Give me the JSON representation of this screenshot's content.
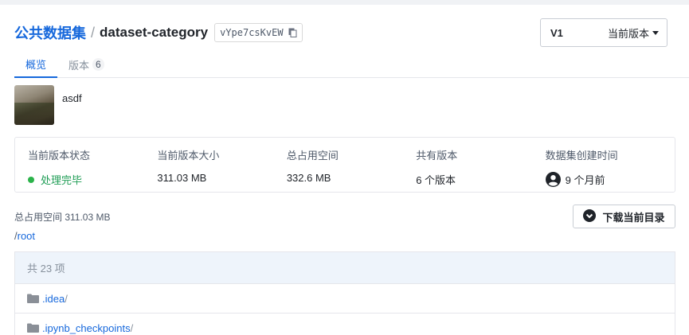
{
  "breadcrumb": {
    "root": "公共数据集",
    "separator": "/",
    "current": "dataset-category"
  },
  "hash": "vYpe7csKvEW",
  "version_select": {
    "value": "V1",
    "label": "当前版本"
  },
  "tabs": [
    {
      "label": "概览",
      "active": true
    },
    {
      "label": "版本",
      "count": "6"
    }
  ],
  "dataset": {
    "name": "asdf"
  },
  "stats": [
    {
      "label": "当前版本状态",
      "value": "处理完毕"
    },
    {
      "label": "当前版本大小",
      "value": "311.03 MB"
    },
    {
      "label": "总占用空间",
      "value": "332.6 MB"
    },
    {
      "label": "共有版本",
      "value": "6 个版本"
    },
    {
      "label": "数据集创建时间",
      "value": "9 个月前"
    }
  ],
  "storage": {
    "total": "总占用空间 311.03 MB",
    "path_prefix": "/",
    "path": "root"
  },
  "download_button": "下载当前目录",
  "file_list": {
    "count_text": "共 23 项",
    "items": [
      {
        "name": ".idea",
        "suffix": "/"
      },
      {
        "name": ".ipynb_checkpoints",
        "suffix": "/"
      }
    ]
  },
  "colors": {
    "accent": "#1668dc",
    "success": "#2bb34a",
    "list_header_bg": "#eef4fb"
  }
}
